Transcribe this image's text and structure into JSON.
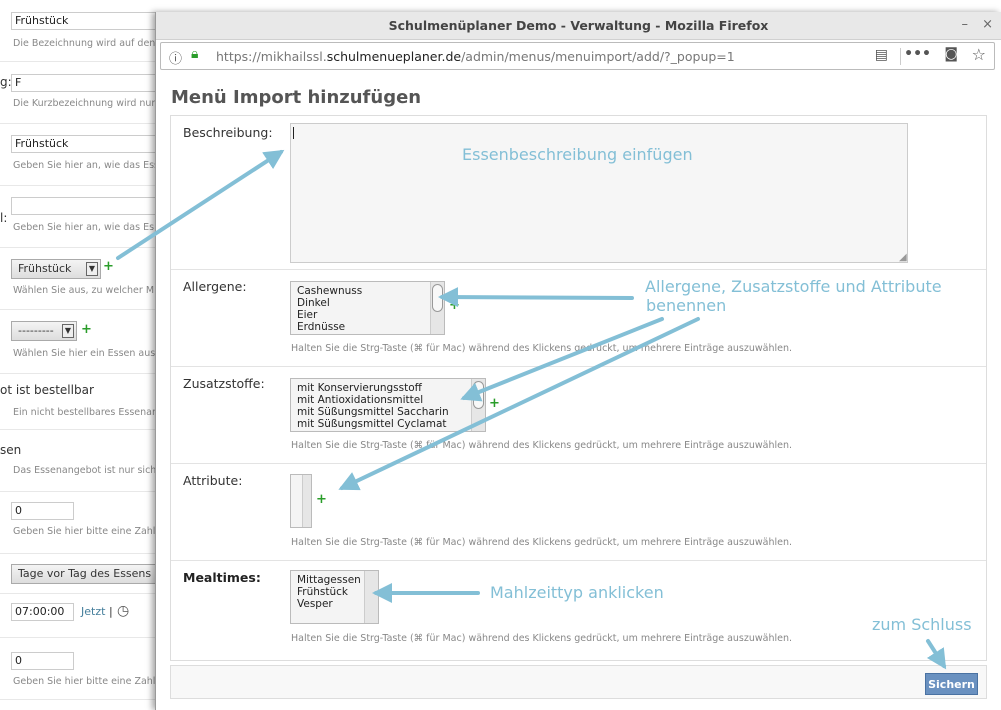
{
  "background_form": {
    "fruehstueck_value": "Frühstück",
    "help_bezeichnung": "Die Bezeichnung wird auf den",
    "kurz_label": "g:",
    "kurz_value": "F",
    "help_kurz": "Die Kurzbezeichnung wird nur",
    "essen_value": "Frühstück",
    "help_essen": "Geben Sie hier an, wie das Ess",
    "l_label": "l:",
    "l_value": "",
    "help_l": "Geben Sie hier an, wie das Es",
    "select1_value": "Frühstück",
    "help_select1": "Wählen Sie aus, zu welcher M",
    "select2_value": "---------",
    "help_select2": "Wählen Sie hier ein Essen aus",
    "bestellbar_label": "ot ist bestellbar",
    "help_bestellbar": "Ein nicht bestellbares Essenan",
    "sen_label": "sen",
    "help_sen": "Das Essenangebot ist nur sich",
    "zahl1_value": "0",
    "help_zahl1": "Geben Sie hier bitte eine Zahl",
    "tage_value": "Tage vor Tag des Essens",
    "time_value": "07:00:00",
    "jetzt_link": "Jetzt",
    "separator": "|",
    "zahl2_value": "0",
    "help_zahl2": "Geben Sie hier bitte eine Zahl"
  },
  "window": {
    "title": "Schulmenüplaner Demo - Verwaltung - Mozilla Firefox",
    "url_prefix": "https://mikhailssl.",
    "url_domain": "schulmenueplaner.de",
    "url_path": "/admin/menus/menuimport/add/?_popup=1",
    "minimize": "–",
    "close": "×"
  },
  "page": {
    "title": "Menü Import hinzufügen",
    "fields": {
      "beschreibung_label": "Beschreibung:",
      "allergene_label": "Allergene:",
      "allergene_options": [
        "Cashewnuss",
        "Dinkel",
        "Eier",
        "Erdnüsse"
      ],
      "zusatzstoffe_label": "Zusatzstoffe:",
      "zusatzstoffe_options": [
        "mit Konservierungsstoff",
        "mit Antioxidationsmittel",
        "mit Süßungsmittel Saccharin",
        "mit Süßungsmittel Cyclamat"
      ],
      "attribute_label": "Attribute:",
      "mealtimes_label": "Mealtimes:",
      "mealtimes_options": [
        "Mittagessen",
        "Frühstück",
        "Vesper"
      ],
      "multi_help": "Halten Sie die Strg-Taste (⌘ für Mac) während des Klickens gedrückt, um mehrere Einträge auszuwählen."
    },
    "save_label": "Sichern"
  },
  "annotations": {
    "beschreibung": "Essenbeschreibung einfügen",
    "allergene_line1": "Allergene, Zusatzstoffe und Attribute",
    "allergene_line2": "benennen",
    "mahlzeit": "Mahlzeittyp anklicken",
    "schluss": "zum Schluss"
  },
  "colors": {
    "annotation": "#83bfd6",
    "save_button": "#6a91c0",
    "add_icon": "#2a9d2a"
  }
}
